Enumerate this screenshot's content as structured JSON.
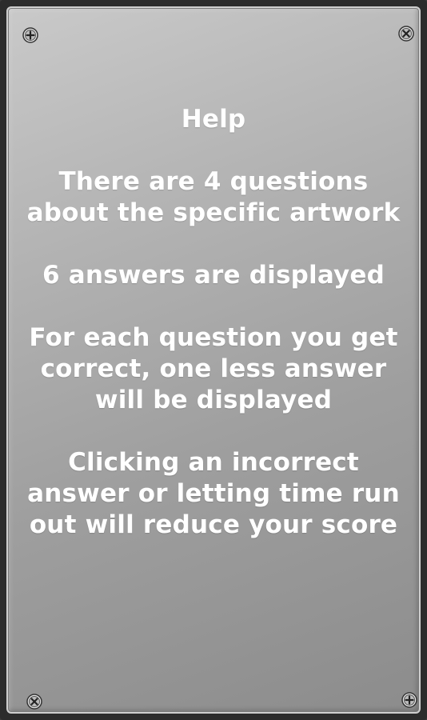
{
  "help": {
    "title": "Help",
    "paragraphs": [
      "There are 4 questions about the specific artwork",
      "6 answers are displayed",
      "For each question you get correct, one less answer will be displayed",
      "Clicking an incorrect answer or letting time run out will reduce your score"
    ]
  },
  "icons": {
    "screws": [
      "screw-icon",
      "screw-icon",
      "screw-icon",
      "screw-icon"
    ]
  },
  "colors": {
    "text": "#ffffff",
    "plate_light": "#c9c9c9",
    "plate_dark": "#8c8c8c",
    "frame": "#2c2c2c"
  }
}
